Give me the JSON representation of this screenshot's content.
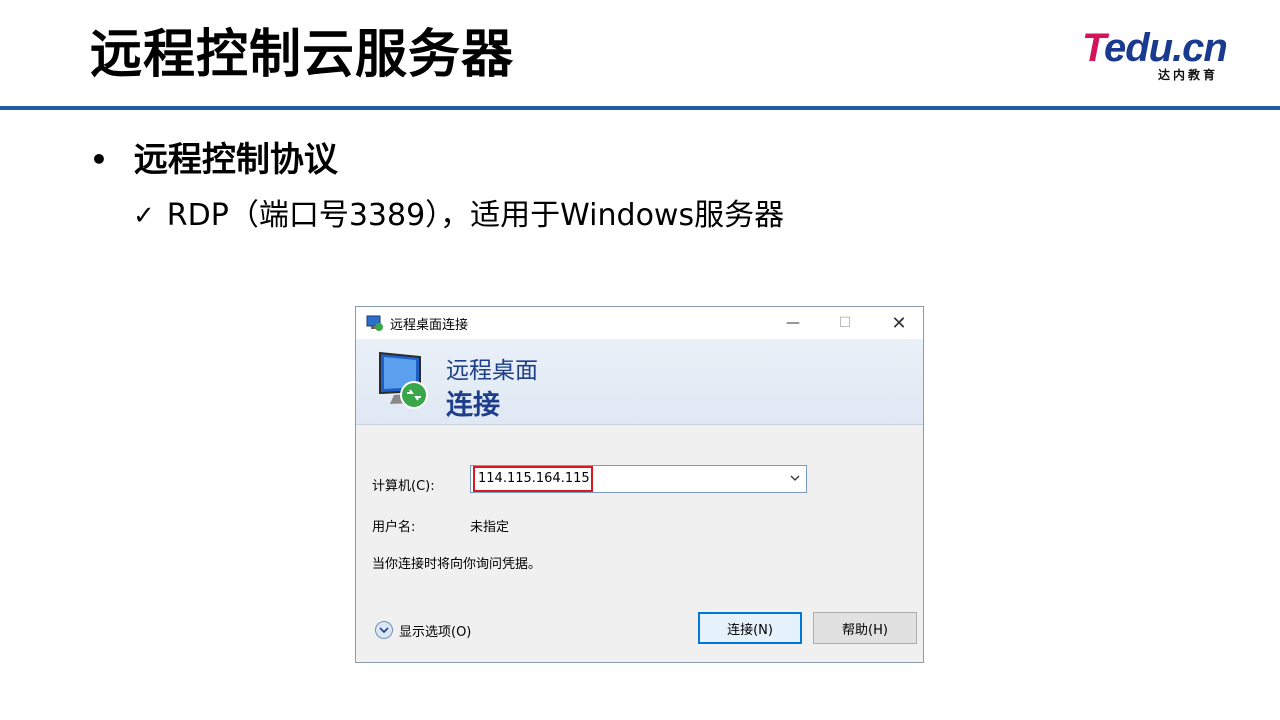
{
  "slide": {
    "title": "远程控制云服务器",
    "logo_main_t": "T",
    "logo_main_rest": "edu.cn",
    "logo_sub": "达内教育",
    "bullet": "远程控制协议",
    "sub_bullet": "RDP（端口号3389），适用于Windows服务器"
  },
  "dialog": {
    "window_title": "远程桌面连接",
    "banner_line1": "远程桌面",
    "banner_line2": "连接",
    "computer_label": "计算机(C):",
    "computer_value": "114.115.164.115",
    "username_label": "用户名:",
    "username_value": "未指定",
    "hint": "当你连接时将向你询问凭据。",
    "show_options": "显示选项(O)",
    "connect_button": "连接(N)",
    "help_button": "帮助(H)",
    "highlight_color": "#e0161e",
    "accent_color": "#1e3e8a"
  }
}
